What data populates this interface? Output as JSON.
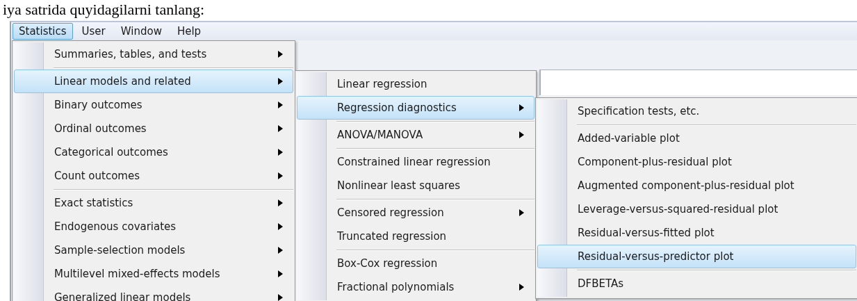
{
  "caption": "iya satrida quyidagilarni tanlang:",
  "menubar": [
    {
      "label": "Statistics",
      "selected": true
    },
    {
      "label": "User",
      "selected": false
    },
    {
      "label": "Window",
      "selected": false
    },
    {
      "label": "Help",
      "selected": false
    }
  ],
  "menus": [
    {
      "items": [
        {
          "kind": "item",
          "label": "Summaries, tables, and tests",
          "submenu": true,
          "selected": false
        },
        {
          "kind": "separator"
        },
        {
          "kind": "item",
          "label": "Linear models and related",
          "submenu": true,
          "selected": true
        },
        {
          "kind": "item",
          "label": "Binary outcomes",
          "submenu": true,
          "selected": false
        },
        {
          "kind": "item",
          "label": "Ordinal outcomes",
          "submenu": true,
          "selected": false
        },
        {
          "kind": "item",
          "label": "Categorical outcomes",
          "submenu": true,
          "selected": false
        },
        {
          "kind": "item",
          "label": "Count outcomes",
          "submenu": true,
          "selected": false
        },
        {
          "kind": "separator"
        },
        {
          "kind": "item",
          "label": "Exact statistics",
          "submenu": true,
          "selected": false
        },
        {
          "kind": "item",
          "label": "Endogenous covariates",
          "submenu": true,
          "selected": false
        },
        {
          "kind": "item",
          "label": "Sample-selection models",
          "submenu": true,
          "selected": false
        },
        {
          "kind": "item",
          "label": "Multilevel mixed-effects models",
          "submenu": true,
          "selected": false
        },
        {
          "kind": "item",
          "label": "Generalized linear models",
          "submenu": true,
          "selected": false
        }
      ]
    },
    {
      "items": [
        {
          "kind": "item",
          "label": "Linear regression",
          "submenu": false,
          "selected": false
        },
        {
          "kind": "item",
          "label": "Regression diagnostics",
          "submenu": true,
          "selected": true
        },
        {
          "kind": "separator"
        },
        {
          "kind": "item",
          "label": "ANOVA/MANOVA",
          "submenu": true,
          "selected": false
        },
        {
          "kind": "separator"
        },
        {
          "kind": "item",
          "label": "Constrained linear regression",
          "submenu": false,
          "selected": false
        },
        {
          "kind": "item",
          "label": "Nonlinear least squares",
          "submenu": false,
          "selected": false
        },
        {
          "kind": "separator"
        },
        {
          "kind": "item",
          "label": "Censored regression",
          "submenu": true,
          "selected": false
        },
        {
          "kind": "item",
          "label": "Truncated regression",
          "submenu": false,
          "selected": false
        },
        {
          "kind": "separator"
        },
        {
          "kind": "item",
          "label": "Box-Cox regression",
          "submenu": false,
          "selected": false
        },
        {
          "kind": "item",
          "label": "Fractional polynomials",
          "submenu": true,
          "selected": false
        }
      ]
    },
    {
      "items": [
        {
          "kind": "item",
          "label": "Specification tests, etc.",
          "submenu": false,
          "selected": false
        },
        {
          "kind": "separator"
        },
        {
          "kind": "item",
          "label": "Added-variable plot",
          "submenu": false,
          "selected": false
        },
        {
          "kind": "item",
          "label": "Component-plus-residual plot",
          "submenu": false,
          "selected": false
        },
        {
          "kind": "item",
          "label": "Augmented component-plus-residual plot",
          "submenu": false,
          "selected": false
        },
        {
          "kind": "item",
          "label": "Leverage-versus-squared-residual plot",
          "submenu": false,
          "selected": false
        },
        {
          "kind": "item",
          "label": "Residual-versus-fitted plot",
          "submenu": false,
          "selected": false
        },
        {
          "kind": "item",
          "label": "Residual-versus-predictor plot",
          "submenu": false,
          "selected": true
        },
        {
          "kind": "separator"
        },
        {
          "kind": "item",
          "label": "DFBETAs",
          "submenu": false,
          "selected": false
        }
      ]
    }
  ]
}
